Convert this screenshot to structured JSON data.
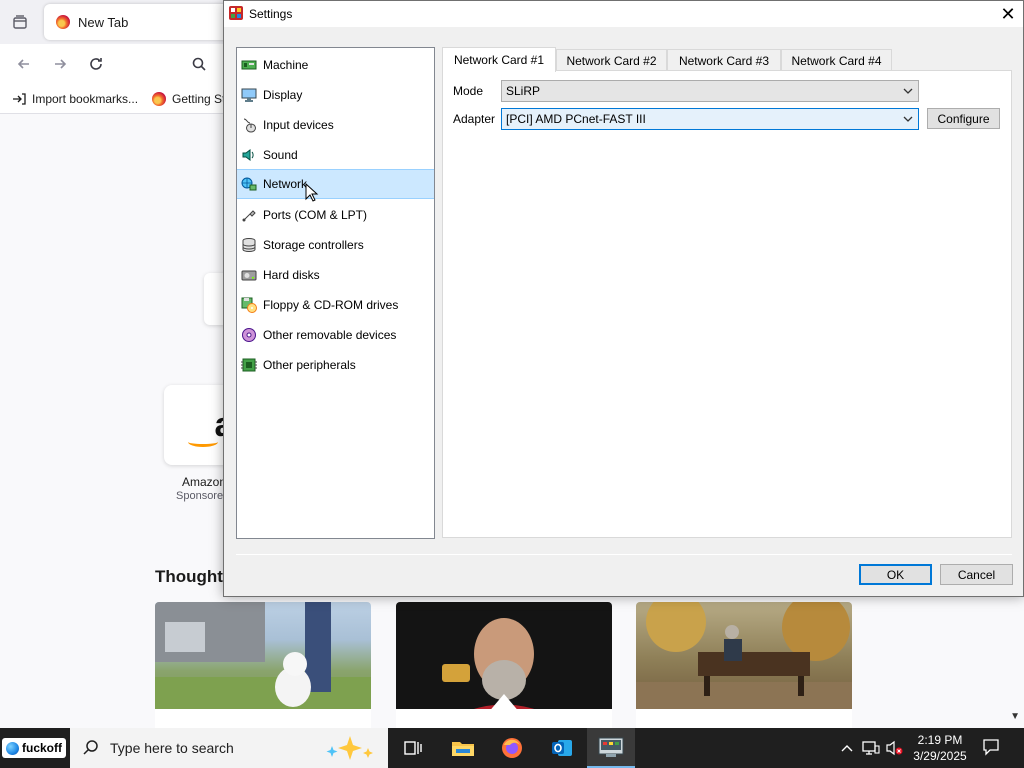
{
  "browser": {
    "tab_title": "New Tab",
    "bookmarks": [
      {
        "label": "Import bookmarks..."
      },
      {
        "label": "Getting St"
      }
    ],
    "shortcut": {
      "label": "Amazon",
      "sublabel": "Sponsored",
      "logo_letter": "a"
    },
    "section_title": "Thought-"
  },
  "dialog": {
    "title": "Settings",
    "categories": [
      {
        "label": "Machine",
        "icon": "machine-icon"
      },
      {
        "label": "Display",
        "icon": "display-icon"
      },
      {
        "label": "Input devices",
        "icon": "input-devices-icon"
      },
      {
        "label": "Sound",
        "icon": "sound-icon"
      },
      {
        "label": "Network",
        "icon": "network-icon",
        "selected": true
      },
      {
        "label": "Ports (COM & LPT)",
        "icon": "ports-icon"
      },
      {
        "label": "Storage controllers",
        "icon": "storage-icon"
      },
      {
        "label": "Hard disks",
        "icon": "hard-disk-icon"
      },
      {
        "label": "Floppy & CD-ROM drives",
        "icon": "floppy-cdrom-icon"
      },
      {
        "label": "Other removable devices",
        "icon": "removable-devices-icon"
      },
      {
        "label": "Other peripherals",
        "icon": "peripherals-icon"
      }
    ],
    "tabs": [
      {
        "label": "Network Card #1",
        "active": true
      },
      {
        "label": "Network Card #2"
      },
      {
        "label": "Network Card #3"
      },
      {
        "label": "Network Card #4"
      }
    ],
    "mode": {
      "label": "Mode",
      "value": "SLiRP"
    },
    "adapter": {
      "label": "Adapter",
      "value": "[PCI] AMD PCnet-FAST III"
    },
    "configure_label": "Configure",
    "ok_label": "OK",
    "cancel_label": "Cancel"
  },
  "taskbar": {
    "start_label": "fuckoff",
    "search_placeholder": "Type here to search",
    "time": "2:19 PM",
    "date": "3/29/2025"
  },
  "colors": {
    "selection": "#cce8ff",
    "accent": "#0078d7",
    "taskbar": "#1f1f1f"
  }
}
